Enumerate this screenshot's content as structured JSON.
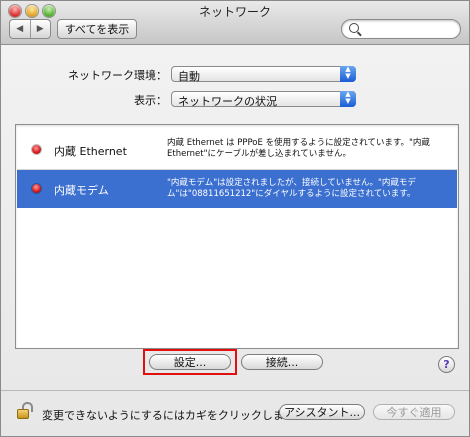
{
  "window": {
    "title": "ネットワーク"
  },
  "toolbar": {
    "back_glyph": "◀",
    "forward_glyph": "▶",
    "show_all_label": "すべてを表示",
    "search_value": ""
  },
  "form": {
    "location_label": "ネットワーク環境：",
    "location_value": "自動",
    "show_label": "表示：",
    "show_value": "ネットワークの状況"
  },
  "services": [
    {
      "name": "内蔵 Ethernet",
      "status_color": "#d61616",
      "description": "内蔵 Ethernet は PPPoE を使用するように設定されています。\"内蔵 Ethernet\"にケーブルが差し込まれていません。",
      "selected": false
    },
    {
      "name": "内蔵モデム",
      "status_color": "#d61616",
      "description": "\"内蔵モデム\"は設定されましたが、接続していません。\"内蔵モデム\"は\"08811651212\"にダイヤルするように設定されています。",
      "selected": true
    }
  ],
  "buttons": {
    "configure_label": "設定...",
    "connect_label": "接続...",
    "help_label": "?",
    "assistant_label": "アシスタント...",
    "apply_label": "今すぐ適用"
  },
  "footer": {
    "lock_text": "変更できないようにするにはカギをクリックします。"
  },
  "colors": {
    "selection": "#3b6fd0",
    "highlight_box": "#e01010",
    "status_red": "#d61616"
  }
}
